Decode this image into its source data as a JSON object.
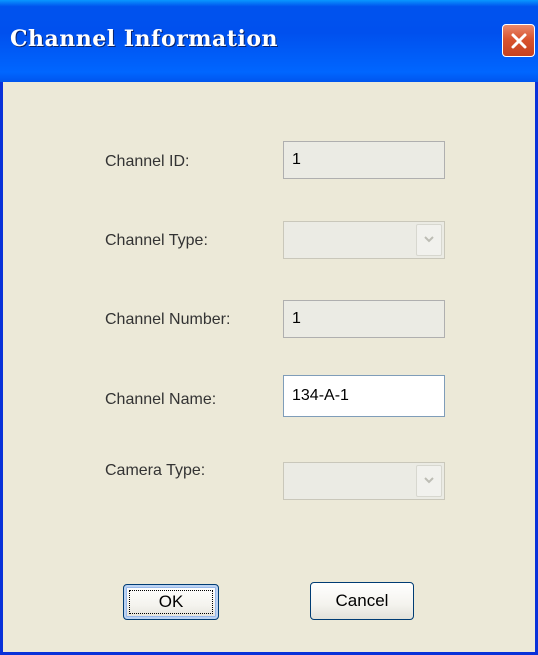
{
  "window": {
    "title": "Channel Information"
  },
  "form": {
    "channel_id": {
      "label": "Channel ID:",
      "value": "1"
    },
    "channel_type": {
      "label": "Channel Type:",
      "value": ""
    },
    "channel_number": {
      "label": "Channel Number:",
      "value": "1"
    },
    "channel_name": {
      "label": "Channel Name:",
      "value": "134-A-1"
    },
    "camera_type": {
      "label": "Camera Type:",
      "value": ""
    }
  },
  "buttons": {
    "ok_label": "OK",
    "cancel_label": "Cancel"
  },
  "icons": {
    "close": "close-icon",
    "dropdown": "chevron-down-icon"
  },
  "colors": {
    "titlebar": "#0053ee",
    "dialog_bg": "#ece9d8",
    "close_button": "#d9542f"
  }
}
